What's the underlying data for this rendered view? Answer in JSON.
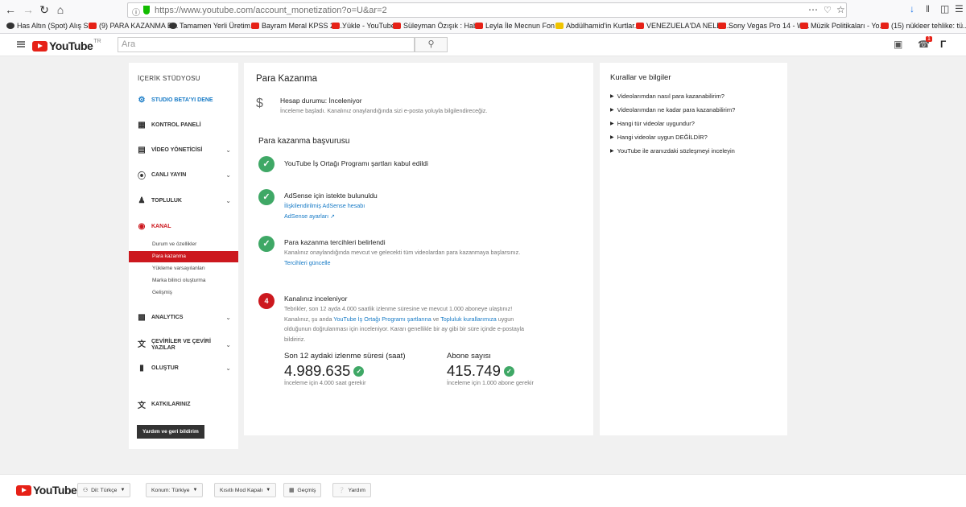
{
  "browser": {
    "url": "https://www.youtube.com/account_monetization?o=U&ar=2",
    "bookmarks": [
      "Has Altın (Spot) Alış S...",
      "(9) PARA KAZANMA E...",
      "Tamamen Yerli Üretim...",
      "Bayram Meral KPSS 20...",
      "Yükle - YouTube",
      "Süleyman Özışık : Hab...",
      "Leyla İle Mecnun Fon ...",
      "Abdülhamid'in Kurtlar...",
      "VENEZUELA'DA NELER...",
      "Sony Vegas Pro 14 - W...",
      "Müzik Politikaları - Yo...",
      "(15) nükleer tehlike: tü..."
    ]
  },
  "header": {
    "logo": "YouTube",
    "country": "TR",
    "search_placeholder": "Ara",
    "notif_count": "1"
  },
  "sidebar": {
    "title": "İÇERİK STÜDYOSU",
    "beta": "STUDIO BETA'YI DENE",
    "items": [
      "KONTROL PANELİ",
      "VİDEO YÖNETİCİSİ",
      "CANLI YAYIN",
      "TOPLULUK",
      "KANAL",
      "ANALYTICS",
      "ÇEVİRİLER VE ÇEVİRİ YAZILAR",
      "OLUŞTUR",
      "KATKILARINIZ"
    ],
    "sub_items": [
      "Durum ve özellikler",
      "Para kazanma",
      "Yükleme varsayılanları",
      "Marka bilinci oluşturma",
      "Gelişmiş"
    ],
    "help": "Yardım ve geri bildirim"
  },
  "main": {
    "title": "Para Kazanma",
    "status_title": "Hesap durumu: İnceleniyor",
    "status_desc": "İnceleme başladı. Kanalınız onaylandığında sizi e-posta yoluyla bilgilendireceğiz.",
    "section": "Para kazanma başvurusu",
    "step1": "YouTube İş Ortağı Programı şartları kabul edildi",
    "step2_title": "AdSense için istekte bulunuldu",
    "step2_link1": "İlişkilendirilmiş AdSense hesabı",
    "step2_link2": "AdSense ayarları",
    "step3_title": "Para kazanma tercihleri belirlendi",
    "step3_text": "Kanalınız onaylandığında mevcut ve gelecekti tüm videolardan para kazanmaya başlarsınız.",
    "step3_link": "Tercihleri güncelle",
    "step4_num": "4",
    "step4_title": "Kanalınız inceleniyor",
    "step4_text_a": "Tebrikler, son 12 ayda 4.000 saatlik izlenme süresine ve mevcut 1.000 aboneye ulaştınız! Kanalınız, şu anda ",
    "step4_link_a": "YouTube İş Ortağı Programı şartlarına",
    "step4_text_b": " ve ",
    "step4_link_b": "Topluluk kurallarımıza",
    "step4_text_c": " uygun olduğunun doğrulanması için inceleniyor. Kararı genellikle bir ay gibi bir süre içinde e-postayla bildiririz.",
    "watch_label": "Son 12 aydaki izlenme süresi (saat)",
    "watch_value": "4.989.635",
    "watch_note": "İnceleme için 4.000 saat gerekir",
    "subs_label": "Abone sayısı",
    "subs_value": "415.749",
    "subs_note": "İnceleme için 1.000 abone gerekir"
  },
  "rules": {
    "title": "Kurallar ve bilgiler",
    "items": [
      "Videolarımdan nasıl para kazanabilirim?",
      "Videolarımdan ne kadar para kazanabilirim?",
      "Hangi tür videolar uygundur?",
      "Hangi videolar uygun DEĞİLDİR?",
      "YouTube ile aranızdaki sözleşmeyi inceleyin"
    ]
  },
  "footer": {
    "language": "Dil: Türkçe",
    "location": "Konum: Türkiye",
    "restricted": "Kısıtlı Mod Kapalı",
    "history": "Geçmiş",
    "help": "Yardım"
  }
}
